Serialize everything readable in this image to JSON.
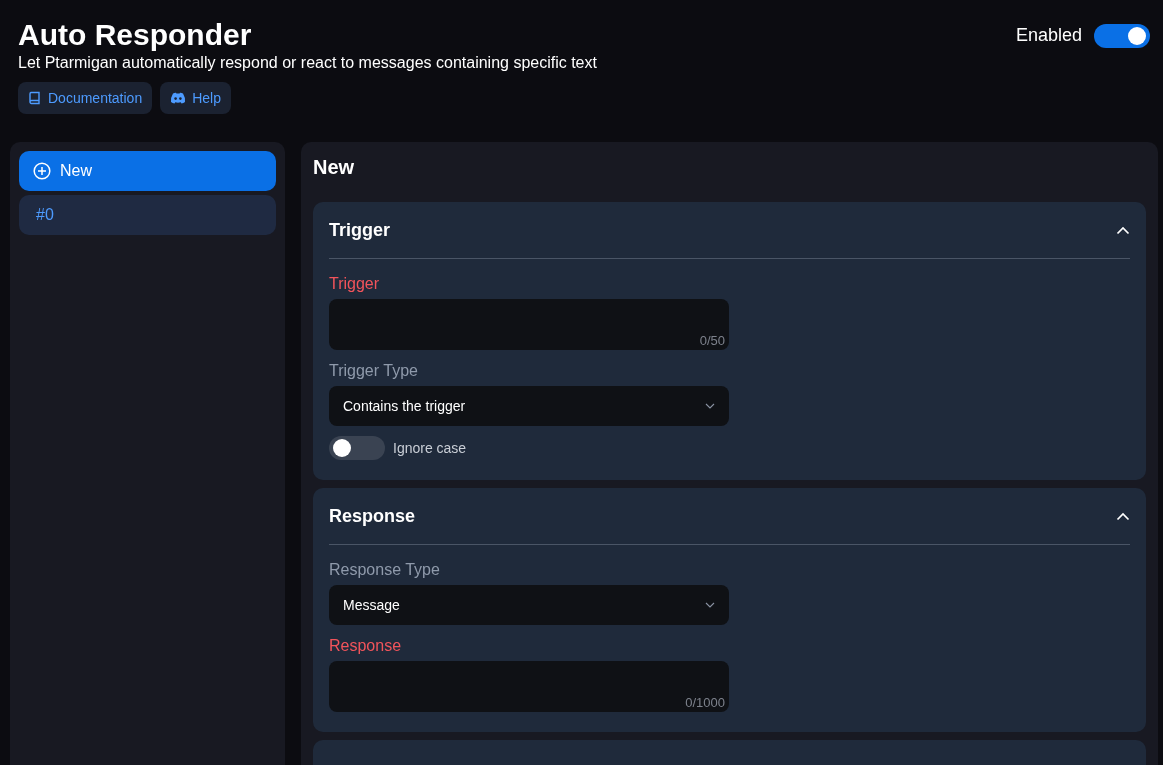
{
  "header": {
    "title": "Auto Responder",
    "subtitle": "Let Ptarmigan automatically respond or react to messages containing specific text",
    "enabled_label": "Enabled",
    "enabled": true,
    "links": [
      {
        "label": "Documentation",
        "kind": "book"
      },
      {
        "label": "Help",
        "kind": "discord"
      }
    ]
  },
  "sidebar": {
    "items": [
      {
        "label": "New",
        "kind": "new",
        "selected": true
      },
      {
        "label": "#0",
        "kind": "entry",
        "selected": false
      }
    ]
  },
  "editor": {
    "title": "New",
    "sections": [
      {
        "title": "Trigger",
        "expanded": true,
        "fields": [
          {
            "kind": "textarea",
            "label": "Trigger",
            "required": true,
            "counter": "0/50"
          },
          {
            "kind": "select",
            "label": "Trigger Type",
            "required": false,
            "value": "Contains the trigger"
          },
          {
            "kind": "switch",
            "label": "Ignore case",
            "on": false
          }
        ]
      },
      {
        "title": "Response",
        "expanded": true,
        "fields": [
          {
            "kind": "select",
            "label": "Response Type",
            "required": false,
            "value": "Message"
          },
          {
            "kind": "textarea",
            "label": "Response",
            "required": true,
            "counter": "0/1000"
          }
        ]
      }
    ]
  }
}
